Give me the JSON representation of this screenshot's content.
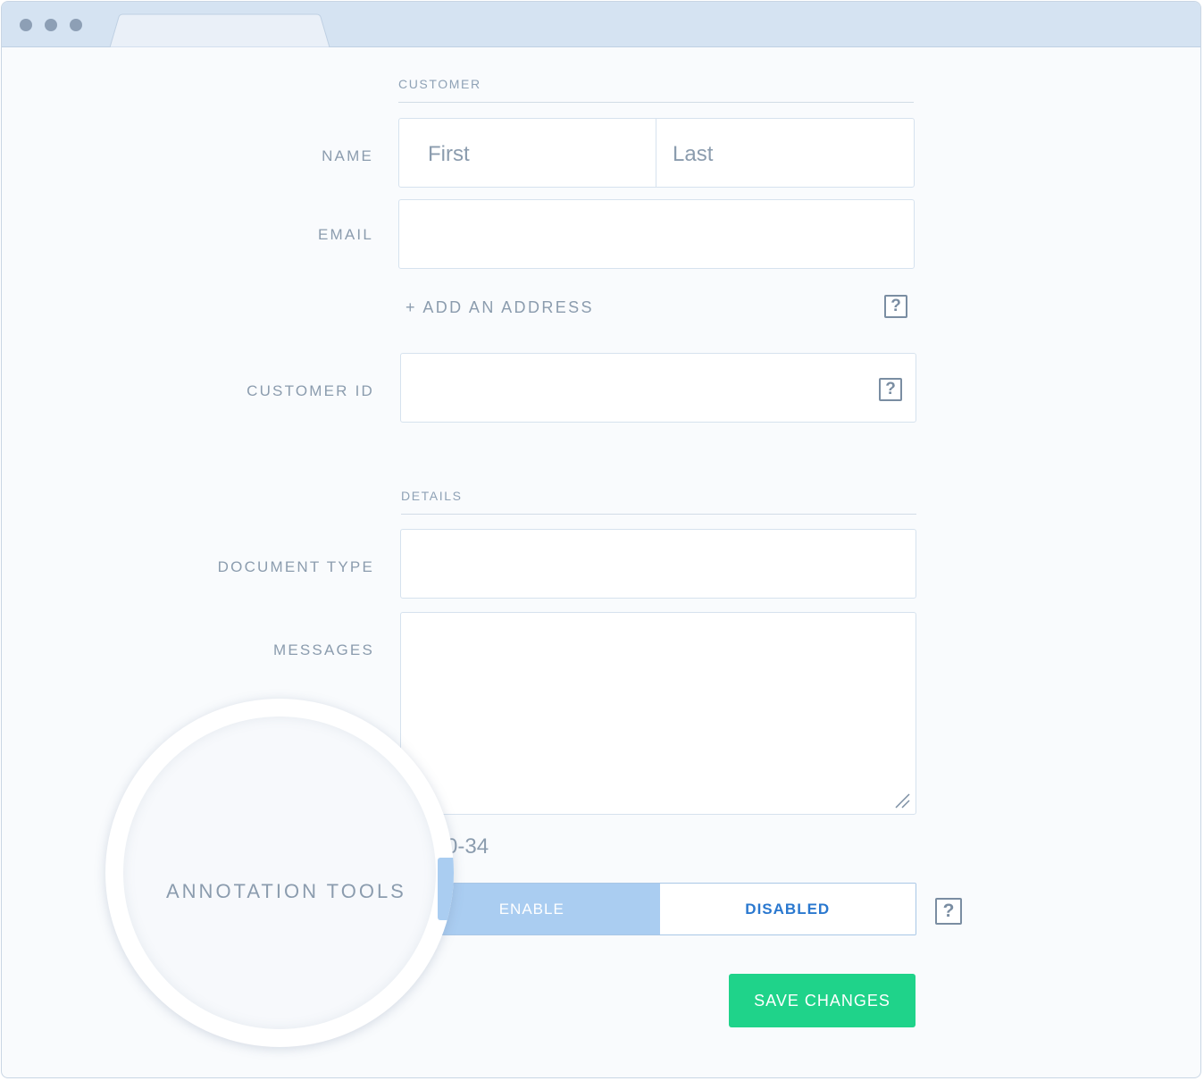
{
  "window": {
    "controls": [
      "window-dot",
      "window-dot",
      "window-dot"
    ]
  },
  "customer_section": {
    "title": "CUSTOMER",
    "name_label": "NAME",
    "first_placeholder": "First",
    "last_placeholder": "Last",
    "email_label": "EMAIL",
    "add_address": "+ ADD AN ADDRESS",
    "customer_id_label": "CUSTOMER ID",
    "help_glyph": "?"
  },
  "details_section": {
    "title": "DETAILS",
    "document_type_label": "DOCUMENT TYPE",
    "messages_label": "MESSAGES",
    "partial_value": "0-34"
  },
  "annotation": {
    "label": "ANNOTATION TOOLS",
    "enable_label": "ENABLE",
    "disabled_label": "DISABLED",
    "selected": "ENABLE"
  },
  "actions": {
    "save_label": "SAVE CHANGES"
  },
  "colors": {
    "titlebar": "#d5e3f2",
    "accent_blue": "#2a78cf",
    "toggle_active": "#aacdf1",
    "save_green": "#1fd38a"
  }
}
